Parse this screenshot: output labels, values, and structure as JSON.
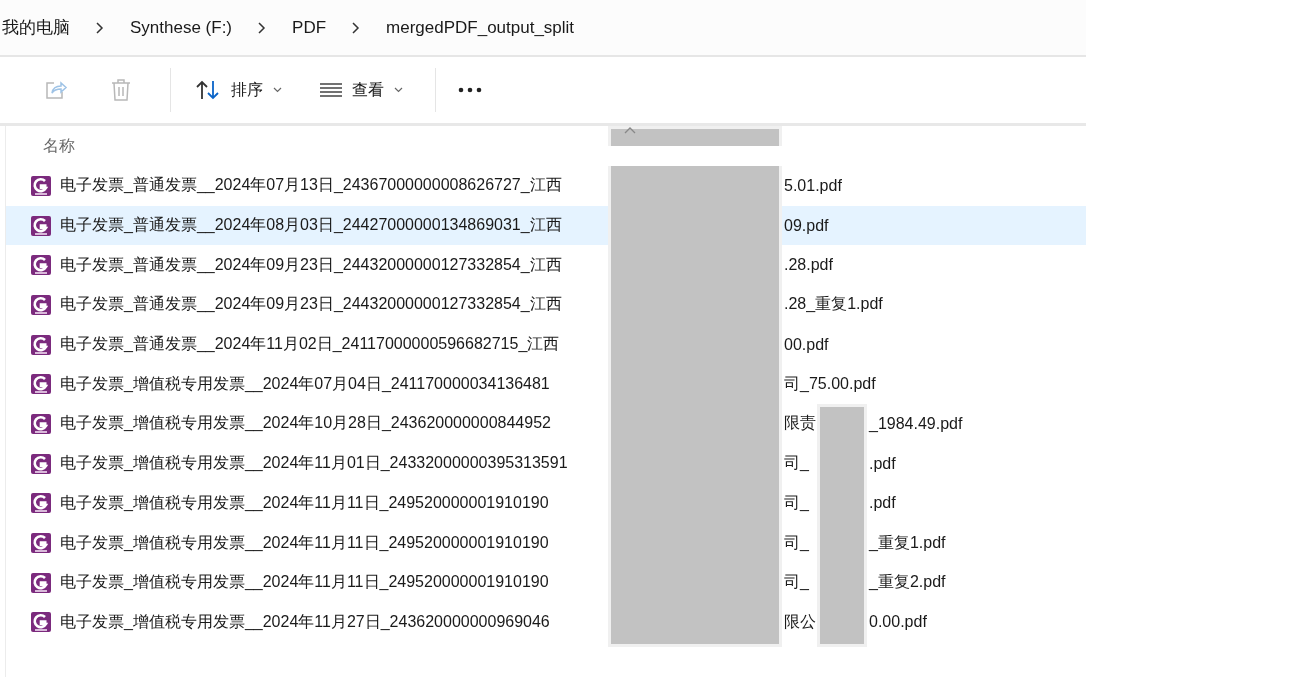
{
  "breadcrumb": [
    {
      "label": "我的电脑"
    },
    {
      "label": "Synthese (F:)"
    },
    {
      "label": "PDF"
    },
    {
      "label": "mergedPDF_output_split"
    }
  ],
  "toolbar": [
    {
      "kind": "share",
      "disabled": true
    },
    {
      "kind": "delete",
      "disabled": true
    },
    {
      "kind": "sort",
      "label": "排序"
    },
    {
      "kind": "view",
      "label": "查看"
    },
    {
      "kind": "more"
    }
  ],
  "columns": [
    {
      "label": "名称",
      "sorted": true
    }
  ],
  "files": [
    {
      "parts": [
        "电子发票_普通发票__2024年07月13日_24367000000008626727_江西",
        "5.01.pdf"
      ],
      "selected": false
    },
    {
      "parts": [
        "电子发票_普通发票__2024年08月03日_24427000000134869031_江西",
        "09.pdf"
      ],
      "selected": true
    },
    {
      "parts": [
        "电子发票_普通发票__2024年09月23日_24432000000127332854_江西",
        ".28.pdf"
      ],
      "selected": false
    },
    {
      "parts": [
        "电子发票_普通发票__2024年09月23日_24432000000127332854_江西",
        ".28_重复1.pdf"
      ],
      "selected": false
    },
    {
      "parts": [
        "电子发票_普通发票__2024年11月02日_24117000000596682715_江西",
        "00.pdf"
      ],
      "selected": false
    },
    {
      "parts": [
        "电子发票_增值税专用发票__2024年07月04日_241170000034136481",
        "司_75.00.pdf"
      ],
      "selected": false
    },
    {
      "parts": [
        "电子发票_增值税专用发票__2024年10月28日_243620000000844952",
        "限责",
        "_1984.49.pdf"
      ],
      "selected": false
    },
    {
      "parts": [
        "电子发票_增值税专用发票__2024年11月01日_24332000000395313591",
        "司_",
        ".pdf"
      ],
      "selected": false
    },
    {
      "parts": [
        "电子发票_增值税专用发票__2024年11月11日_249520000001910190",
        "司_",
        ".pdf"
      ],
      "selected": false
    },
    {
      "parts": [
        "电子发票_增值税专用发票__2024年11月11日_249520000001910190",
        "司_",
        "_重复1.pdf"
      ],
      "selected": false
    },
    {
      "parts": [
        "电子发票_增值税专用发票__2024年11月11日_249520000001910190",
        "司_",
        "_重复2.pdf"
      ],
      "selected": false
    },
    {
      "parts": [
        "电子发票_增值税专用发票__2024年11月27日_243620000000969046",
        "限公",
        "0.00.pdf"
      ],
      "selected": false
    }
  ]
}
